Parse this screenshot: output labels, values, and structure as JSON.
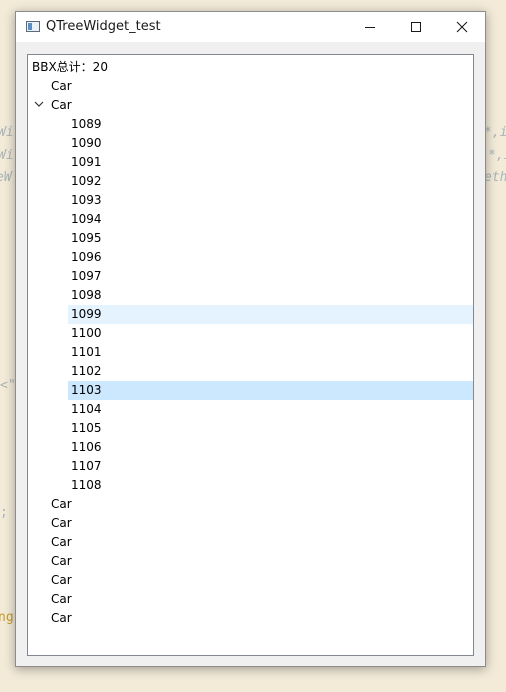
{
  "window": {
    "title": "QTreeWidget_test"
  },
  "background_code": {
    "line1_left": "Wi",
    "line2_left": "Wi",
    "line3_left": "eW",
    "line1_right": "*,in",
    "line2_right": "*,i",
    "line3_right": "eth",
    "line4_left": "<\"",
    "line5_left": ";",
    "line6_left": "ng"
  },
  "tree": {
    "header_row": "BBX总计：20",
    "top_items": [
      "Car",
      "Car",
      "Car",
      "Car",
      "Car",
      "Car",
      "Car",
      "Car",
      "Car"
    ],
    "expanded_index": 1,
    "children": [
      "1089",
      "1090",
      "1091",
      "1092",
      "1093",
      "1094",
      "1095",
      "1096",
      "1097",
      "1098",
      "1099",
      "1100",
      "1101",
      "1102",
      "1103",
      "1104",
      "1105",
      "1106",
      "1107",
      "1108"
    ],
    "hovered_child": "1099",
    "selected_child": "1103"
  },
  "colors": {
    "selection": "#cce8ff",
    "hover": "#e5f3ff"
  }
}
